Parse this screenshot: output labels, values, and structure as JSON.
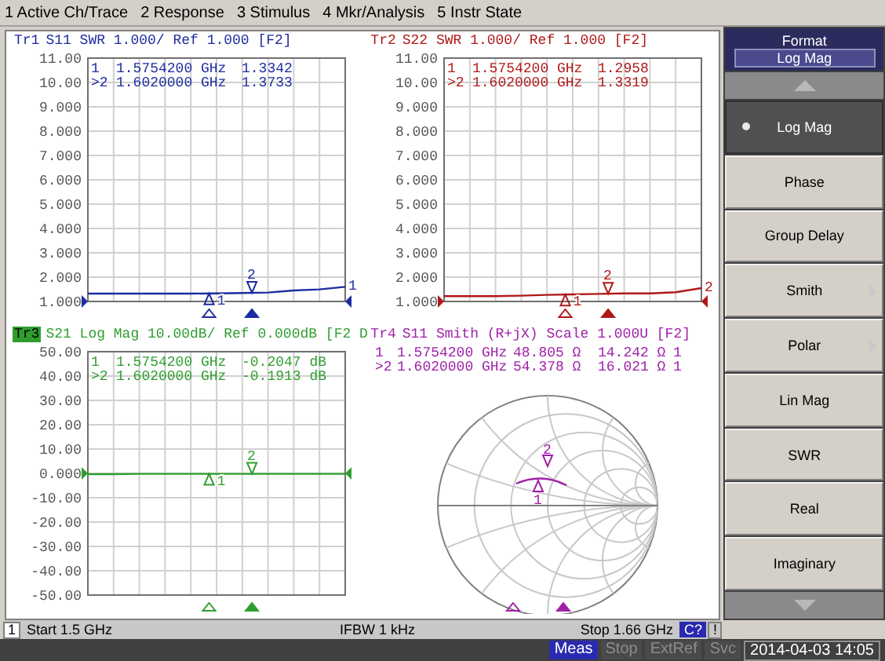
{
  "menu": [
    {
      "label": "1 Active Ch/Trace"
    },
    {
      "label": "2 Response"
    },
    {
      "label": "3 Stimulus"
    },
    {
      "label": "4 Mkr/Analysis"
    },
    {
      "label": "5 Instr State"
    }
  ],
  "panes": [
    {
      "kind": "cartesian",
      "trace": "Tr1",
      "title": "S11 SWR 1.000/ Ref 1.000 [F2]",
      "active": false,
      "color": "#1c2ca0",
      "end_label": "1",
      "readouts": [
        {
          "label": "1",
          "freq": "1.5754200 GHz",
          "values": [
            "1.3342"
          ]
        },
        {
          "label": ">2",
          "freq": "1.6020000 GHz",
          "values": [
            "1.3733"
          ]
        }
      ],
      "markers": [
        {
          "label": "1",
          "active": false
        },
        {
          "label": "2",
          "active": true
        }
      ],
      "chart_data": {
        "type": "line",
        "categories": [
          null,
          null,
          null,
          null,
          null,
          null,
          null,
          null,
          null,
          null,
          null
        ],
        "ylim": [
          1,
          11
        ],
        "yticks": [
          {
            "value": 11,
            "label": "11.00"
          },
          {
            "value": 10,
            "label": "10.00"
          },
          {
            "value": 9,
            "label": "9.000"
          },
          {
            "value": 8,
            "label": "8.000"
          },
          {
            "value": 7,
            "label": "7.000"
          },
          {
            "value": 6,
            "label": "6.000"
          },
          {
            "value": 5,
            "label": "5.000"
          },
          {
            "value": 4,
            "label": "4.000"
          },
          {
            "value": 3,
            "label": "3.000"
          },
          {
            "value": 2,
            "label": "2.000"
          },
          {
            "value": 1,
            "label": "1.000"
          }
        ],
        "grid": true,
        "series": [
          {
            "color": "#1c2ca0",
            "values": [
              1.32,
              1.32,
              1.32,
              1.32,
              1.32,
              1.33,
              1.35,
              1.37,
              1.45,
              1.5,
              1.6
            ]
          }
        ]
      }
    },
    {
      "kind": "cartesian",
      "trace": "Tr2",
      "title": "S22 SWR 1.000/ Ref 1.000 [F2]",
      "active": false,
      "color": "#b01818",
      "end_label": "2",
      "readouts": [
        {
          "label": "1",
          "freq": "1.5754200 GHz",
          "values": [
            "1.2958"
          ]
        },
        {
          "label": ">2",
          "freq": "1.6020000 GHz",
          "values": [
            "1.3319"
          ]
        }
      ],
      "markers": [
        {
          "label": "1",
          "active": false
        },
        {
          "label": "2",
          "active": true
        }
      ],
      "chart_data": {
        "type": "line",
        "categories": [
          null,
          null,
          null,
          null,
          null,
          null,
          null,
          null,
          null,
          null,
          null
        ],
        "ylim": [
          1,
          11
        ],
        "yticks": [
          {
            "value": 11,
            "label": "11.00"
          },
          {
            "value": 10,
            "label": "10.00"
          },
          {
            "value": 9,
            "label": "9.000"
          },
          {
            "value": 8,
            "label": "8.000"
          },
          {
            "value": 7,
            "label": "7.000"
          },
          {
            "value": 6,
            "label": "6.000"
          },
          {
            "value": 5,
            "label": "5.000"
          },
          {
            "value": 4,
            "label": "4.000"
          },
          {
            "value": 3,
            "label": "3.000"
          },
          {
            "value": 2,
            "label": "2.000"
          },
          {
            "value": 1,
            "label": "1.000"
          }
        ],
        "grid": true,
        "series": [
          {
            "color": "#b01818",
            "values": [
              1.22,
              1.22,
              1.22,
              1.24,
              1.27,
              1.29,
              1.31,
              1.33,
              1.33,
              1.38,
              1.55
            ]
          }
        ]
      }
    },
    {
      "kind": "cartesian",
      "trace": "Tr3",
      "title": "S21 Log Mag 10.00dB/ Ref 0.000dB [F2 D",
      "active": true,
      "color": "#2f9e2f",
      "readouts": [
        {
          "label": "1",
          "freq": "1.5754200 GHz",
          "values": [
            "-0.2047 dB"
          ]
        },
        {
          "label": ">2",
          "freq": "1.6020000 GHz",
          "values": [
            "-0.1913 dB"
          ]
        }
      ],
      "markers": [
        {
          "label": "1",
          "active": false
        },
        {
          "label": "2",
          "active": true
        }
      ],
      "chart_data": {
        "type": "line",
        "categories": [
          null,
          null,
          null,
          null,
          null,
          null,
          null,
          null,
          null,
          null,
          null
        ],
        "ylim": [
          -50,
          50
        ],
        "yticks": [
          {
            "value": 50,
            "label": "50.00"
          },
          {
            "value": 40,
            "label": "40.00"
          },
          {
            "value": 30,
            "label": "30.00"
          },
          {
            "value": 20,
            "label": "20.00"
          },
          {
            "value": 10,
            "label": "10.00"
          },
          {
            "value": 0,
            "label": "0.000"
          },
          {
            "value": -10,
            "label": "-10.00"
          },
          {
            "value": -20,
            "label": "-20.00"
          },
          {
            "value": -30,
            "label": "-30.00"
          },
          {
            "value": -40,
            "label": "-40.00"
          },
          {
            "value": -50,
            "label": "-50.00"
          }
        ],
        "grid": true,
        "series": [
          {
            "color": "#2f9e2f",
            "values": [
              -0.3,
              -0.3,
              -0.2,
              -0.2,
              -0.2,
              -0.2,
              -0.2,
              -0.2,
              -0.2,
              -0.2,
              -0.2
            ]
          }
        ]
      }
    },
    {
      "kind": "smith",
      "trace": "Tr4",
      "title": "S11 Smith (R+jX) Scale 1.000U [F2]",
      "active": false,
      "color": "#a020a8",
      "readouts": [
        {
          "label": "1",
          "freq": "1.5754200 GHz",
          "values": [
            "48.805 Ω",
            "14.242 Ω",
            "1"
          ]
        },
        {
          "label": ">2",
          "freq": "1.6020000 GHz",
          "values": [
            "54.378 Ω",
            "16.021 Ω",
            "1"
          ]
        }
      ],
      "markers": [
        {
          "label": "1",
          "active": false
        },
        {
          "label": "2",
          "active": true
        }
      ]
    }
  ],
  "softkeys": {
    "title": "Format",
    "value": "Log Mag",
    "items": [
      {
        "label": "Log Mag",
        "selected": true,
        "submenu": false
      },
      {
        "label": "Phase",
        "selected": false,
        "submenu": false
      },
      {
        "label": "Group Delay",
        "selected": false,
        "submenu": false
      },
      {
        "label": "Smith",
        "selected": false,
        "submenu": true
      },
      {
        "label": "Polar",
        "selected": false,
        "submenu": true
      },
      {
        "label": "Lin Mag",
        "selected": false,
        "submenu": false
      },
      {
        "label": "SWR",
        "selected": false,
        "submenu": false
      },
      {
        "label": "Real",
        "selected": false,
        "submenu": false
      },
      {
        "label": "Imaginary",
        "selected": false,
        "submenu": false
      }
    ]
  },
  "status": {
    "channel": "1",
    "start": "Start 1.5 GHz",
    "ifbw": "IFBW 1 kHz",
    "stop": "Stop 1.66 GHz",
    "cal": "C?",
    "warning": "!"
  },
  "bottom_bar": {
    "buttons": [
      {
        "label": "Meas",
        "on": true
      },
      {
        "label": "Stop",
        "on": false
      },
      {
        "label": "ExtRef",
        "on": false
      },
      {
        "label": "Svc",
        "on": false
      }
    ],
    "datetime": "2014-04-03 14:05"
  }
}
